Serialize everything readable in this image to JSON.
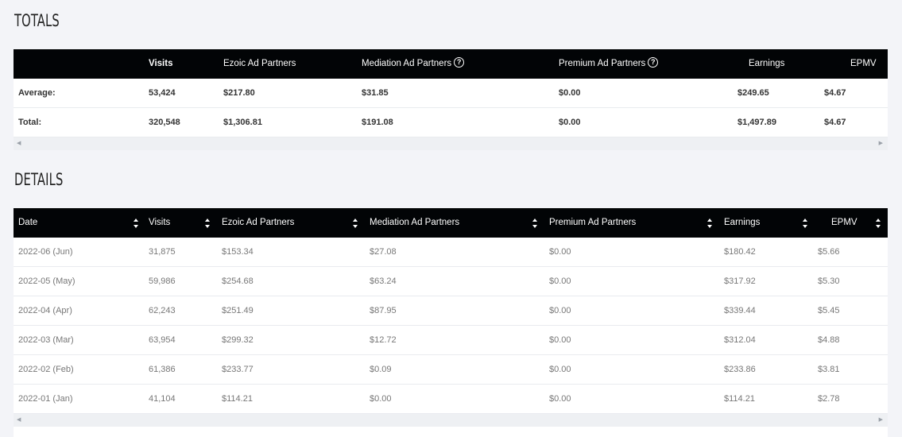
{
  "totals": {
    "title": "TOTALS",
    "headers": [
      "",
      "Visits",
      "Ezoic Ad Partners",
      "Mediation Ad Partners",
      "Premium Ad Partners",
      "Earnings",
      "EPMV"
    ],
    "rows": [
      [
        "Average:",
        "53,424",
        "$217.80",
        "$31.85",
        "$0.00",
        "$249.65",
        "$4.67"
      ],
      [
        "Total:",
        "320,548",
        "$1,306.81",
        "$191.08",
        "$0.00",
        "$1,497.89",
        "$4.67"
      ]
    ]
  },
  "details": {
    "title": "DETAILS",
    "headers": [
      "Date",
      "Visits",
      "Ezoic Ad Partners",
      "Mediation Ad Partners",
      "Premium Ad Partners",
      "Earnings",
      "EPMV"
    ],
    "rows": [
      [
        "2022-06 (Jun)",
        "31,875",
        "$153.34",
        "$27.08",
        "$0.00",
        "$180.42",
        "$5.66"
      ],
      [
        "2022-05 (May)",
        "59,986",
        "$254.68",
        "$63.24",
        "$0.00",
        "$317.92",
        "$5.30"
      ],
      [
        "2022-04 (Apr)",
        "62,243",
        "$251.49",
        "$87.95",
        "$0.00",
        "$339.44",
        "$5.45"
      ],
      [
        "2022-03 (Mar)",
        "63,954",
        "$299.32",
        "$12.72",
        "$0.00",
        "$312.04",
        "$4.88"
      ],
      [
        "2022-02 (Feb)",
        "61,386",
        "$233.77",
        "$0.09",
        "$0.00",
        "$233.86",
        "$3.81"
      ],
      [
        "2022-01 (Jan)",
        "41,104",
        "$114.21",
        "$0.00",
        "$0.00",
        "$114.21",
        "$2.78"
      ]
    ]
  },
  "icons": {
    "help": "question-circle-icon",
    "sort": "sort-arrows-icon",
    "scroll_left": "scroll-left-arrow-icon",
    "scroll_right": "scroll-right-arrow-icon"
  },
  "help_glyph": "?",
  "colors": {
    "header_bg": "#020406",
    "page_bg": "#f3f4f8"
  }
}
